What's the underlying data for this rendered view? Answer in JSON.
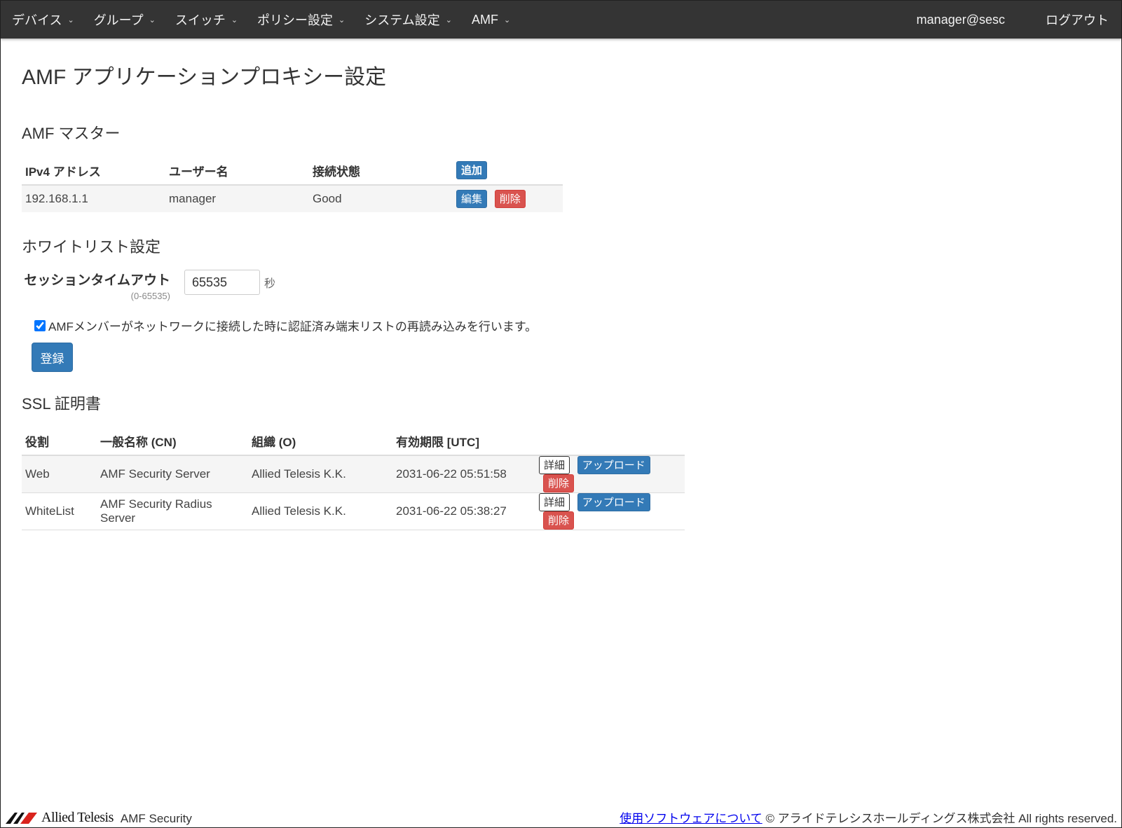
{
  "nav": {
    "menus": [
      {
        "label": "デバイス"
      },
      {
        "label": "グループ"
      },
      {
        "label": "スイッチ"
      },
      {
        "label": "ポリシー設定"
      },
      {
        "label": "システム設定"
      },
      {
        "label": "AMF"
      }
    ],
    "user": "manager@sesc",
    "logout": "ログアウト"
  },
  "page": {
    "title": "AMF アプリケーションプロキシー設定"
  },
  "amf_master": {
    "title": "AMF マスター",
    "headers": {
      "ip": "IPv4 アドレス",
      "user": "ユーザー名",
      "status": "接続状態"
    },
    "add_label": "追加",
    "rows": [
      {
        "ip": "192.168.1.1",
        "user": "manager",
        "status": "Good",
        "edit": "編集",
        "delete": "削除"
      }
    ]
  },
  "whitelist": {
    "title": "ホワイトリスト設定",
    "timeout_label": "セッションタイムアウト",
    "timeout_range": "(0-65535)",
    "timeout_value": "65535",
    "timeout_unit": "秒",
    "reload_checked": true,
    "reload_label": "AMFメンバーがネットワークに接続した時に認証済み端末リストの再読み込みを行います。",
    "register_label": "登録"
  },
  "ssl": {
    "title": "SSL 証明書",
    "headers": {
      "role": "役割",
      "cn": "一般名称 (CN)",
      "org": "組織 (O)",
      "expiry": "有効期限 [UTC]"
    },
    "rows": [
      {
        "role": "Web",
        "cn": "AMF Security Server",
        "org": "Allied Telesis K.K.",
        "expiry": "2031-06-22 05:51:58",
        "detail": "詳細",
        "upload": "アップロード",
        "delete": "削除"
      },
      {
        "role": "WhiteList",
        "cn": "AMF Security Radius Server",
        "org": "Allied Telesis K.K.",
        "expiry": "2031-06-22 05:38:27",
        "detail": "詳細",
        "upload": "アップロード",
        "delete": "削除"
      }
    ]
  },
  "footer": {
    "logo_text": "Allied Telesis",
    "product": "AMF Security",
    "software_link": "使用ソフトウェアについて",
    "copyright": "© アライドテレシスホールディングス株式会社 All rights reserved."
  }
}
